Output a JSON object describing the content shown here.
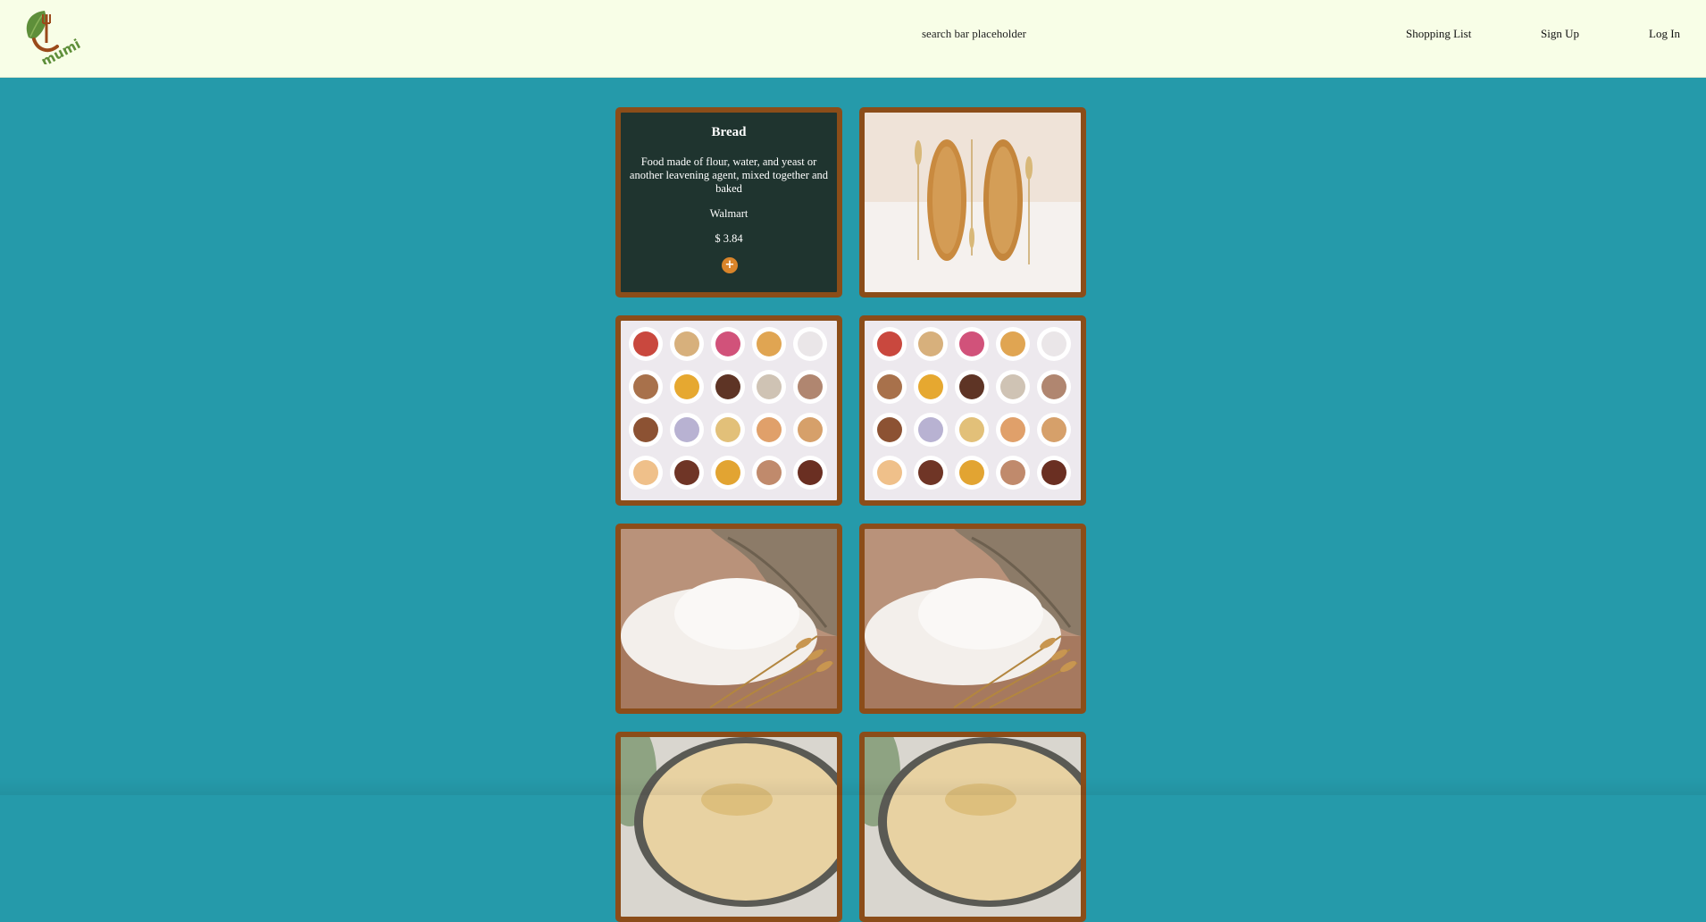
{
  "header": {
    "logo_text": "mumi",
    "search_placeholder": "search bar placeholder",
    "nav": {
      "shopping_list": "Shopping List",
      "sign_up": "Sign Up",
      "log_in": "Log In"
    }
  },
  "colors": {
    "page_background": "#259aaa",
    "header_background": "#f8fee7",
    "card_border": "#8b4d19",
    "info_card_background": "#1f342f",
    "add_button": "#d9842a"
  },
  "products": [
    {
      "name": "Bread",
      "description": "Food made of flour, water, and yeast or another leavening agent, mixed together and baked",
      "store": "Walmart",
      "price": "$ 3.84",
      "add_icon": "plus-icon",
      "image": "bread-loaves-image"
    },
    {
      "image": "cereal-bowls-image"
    },
    {
      "image": "cereal-bowls-image"
    },
    {
      "image": "flour-sack-image"
    },
    {
      "image": "flour-sack-image"
    },
    {
      "image": "porridge-bowl-image"
    },
    {
      "image": "porridge-bowl-image"
    }
  ]
}
